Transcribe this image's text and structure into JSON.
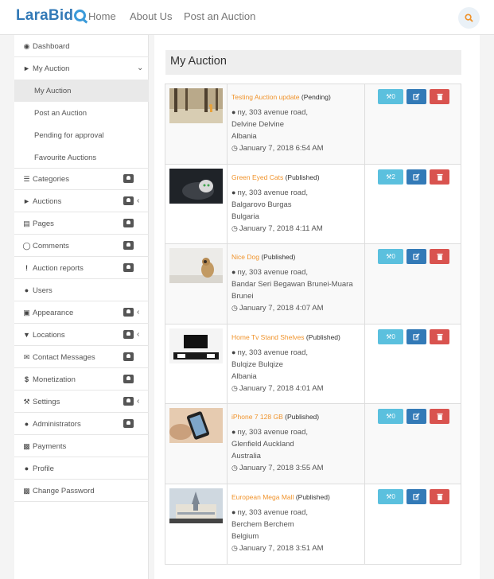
{
  "brand": {
    "name": "LaraBid"
  },
  "nav": {
    "home": "Home",
    "about": "About Us",
    "post": "Post an Auction"
  },
  "sidebar": {
    "dashboard": "Dashboard",
    "my_auction": "My Auction",
    "sub": [
      "My Auction",
      "Post an Auction",
      "Pending for approval",
      "Favourite Auctions"
    ],
    "categories": "Categories",
    "auctions": "Auctions",
    "pages": "Pages",
    "comments": "Comments",
    "auction_reports": "Auction reports",
    "users": "Users",
    "appearance": "Appearance",
    "locations": "Locations",
    "contact_messages": "Contact Messages",
    "monetization": "Monetization",
    "settings": "Settings",
    "administrators": "Administrators",
    "payments": "Payments",
    "profile": "Profile",
    "change_password": "Change Password"
  },
  "main": {
    "title": "My Auction",
    "auctions": [
      {
        "title": "Testing Auction update",
        "status": "(Pending)",
        "address": "ny, 303 avenue road,",
        "city": "Delvine Delvine",
        "country": "Albania",
        "date": "January 7, 2018 6:54 AM",
        "bids": "0"
      },
      {
        "title": "Green Eyed Cats",
        "status": "(Published)",
        "address": "ny, 303 avenue road,",
        "city": "Balgarovo Burgas",
        "country": "Bulgaria",
        "date": "January 7, 2018 4:11 AM",
        "bids": "2"
      },
      {
        "title": "Nice Dog",
        "status": "(Published)",
        "address": "ny, 303 avenue road,",
        "city": "Bandar Seri Begawan Brunei-Muara",
        "country": "Brunei",
        "date": "January 7, 2018 4:07 AM",
        "bids": "0"
      },
      {
        "title": "Home Tv Stand Shelves",
        "status": "(Published)",
        "address": "ny, 303 avenue road,",
        "city": "Bulqize Bulqize",
        "country": "Albania",
        "date": "January 7, 2018 4:01 AM",
        "bids": "0"
      },
      {
        "title": "iPhone 7 128 GB",
        "status": "(Published)",
        "address": "ny, 303 avenue road,",
        "city": "Glenfield Auckland",
        "country": "Australia",
        "date": "January 7, 2018 3:55 AM",
        "bids": "0"
      },
      {
        "title": "European Mega Mall",
        "status": "(Published)",
        "address": "ny, 303 avenue road,",
        "city": "Berchem Berchem",
        "country": "Belgium",
        "date": "January 7, 2018 3:51 AM",
        "bids": "0"
      }
    ]
  },
  "icons": {
    "search": "search-icon",
    "dashboard": "dashboard-icon",
    "megaphone": "megaphone-icon",
    "list": "list-icon",
    "file": "file-icon",
    "comment": "comment-icon",
    "exclamation": "exclamation-icon",
    "users": "users-icon",
    "monitor": "monitor-icon",
    "map-marker": "map-marker-icon",
    "envelope": "envelope-icon",
    "dollar": "dollar-icon",
    "wrench": "wrench-icon",
    "money": "money-icon",
    "user": "user-icon",
    "lock": "lock-icon",
    "gavel": "gavel-icon",
    "edit": "edit-icon",
    "trash": "trash-icon",
    "clock": "clock-icon"
  },
  "colors": {
    "brand": "#337ab7",
    "accent": "#f0932b",
    "info": "#5bc0de",
    "primary": "#337ab7",
    "danger": "#d9534f"
  }
}
